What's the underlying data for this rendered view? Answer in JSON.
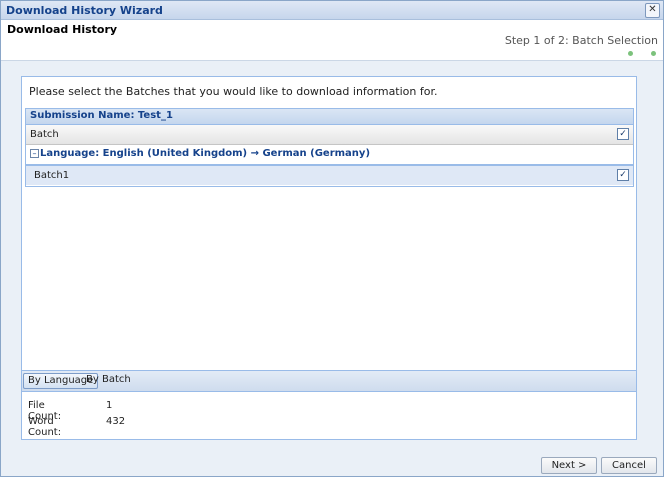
{
  "window": {
    "title": "Download History Wizard"
  },
  "header": {
    "title": "Download History",
    "step": "Step 1 of 2: Batch Selection"
  },
  "main": {
    "instruction": "Please select the Batches that you would like to download information for.",
    "grid": {
      "title": "Submission Name: Test_1",
      "column_header": "Batch",
      "header_checked": "✓",
      "group_toggle": "–",
      "group_label": "Language: English (United Kingdom) → German (Germany)",
      "rows": [
        {
          "label": "Batch1",
          "checked": "✓"
        }
      ]
    },
    "tabs": [
      {
        "label": "By Language"
      },
      {
        "label": "By Batch"
      }
    ],
    "stats": {
      "file_count_label": "File Count:",
      "file_count": "1",
      "word_count_label": "Word Count:",
      "word_count": "432"
    }
  },
  "footer": {
    "next_label": "Next >",
    "cancel_label": "Cancel"
  },
  "colors": {
    "accent": "#15428b",
    "panel_border": "#99bbe8",
    "row_selected": "#dfe8f6",
    "step_dot": "#7cc27c"
  },
  "icons": {
    "close": "close-icon",
    "checkbox": "checkbox-icon",
    "collapse": "collapse-icon"
  }
}
